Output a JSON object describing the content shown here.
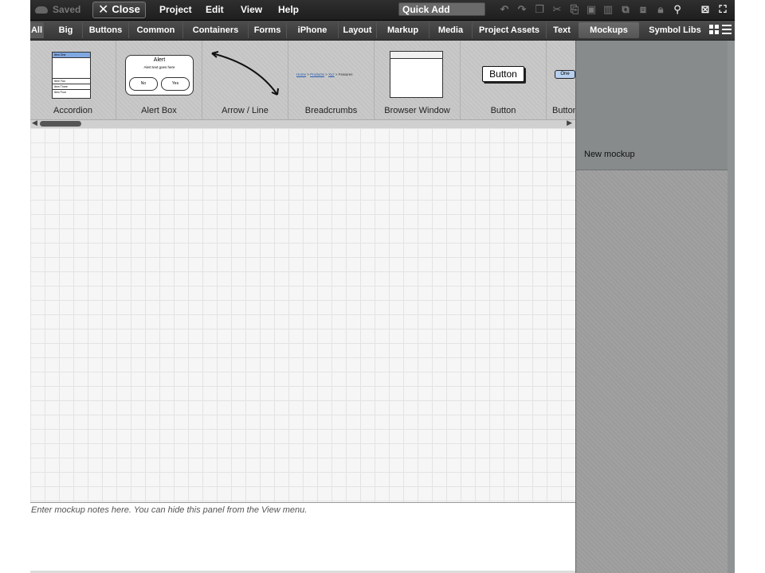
{
  "menubar": {
    "saved_label": "Saved",
    "close_label": "Close",
    "menus": [
      "Project",
      "Edit",
      "View",
      "Help"
    ],
    "quick_add": "Quick Add"
  },
  "categories": {
    "tabs": [
      "All",
      "Big",
      "Buttons",
      "Common",
      "Containers",
      "Forms",
      "iPhone",
      "Layout",
      "Markup",
      "Media",
      "Project Assets",
      "Text"
    ],
    "active": "All"
  },
  "right_tabs": {
    "mockups": "Mockups",
    "symbol_libs": "Symbol Libs"
  },
  "library": {
    "items": [
      "Accordion",
      "Alert Box",
      "Arrow / Line",
      "Breadcrumbs",
      "Browser Window",
      "Button",
      "Button Bar"
    ],
    "accordion_rows": [
      "Item One",
      "Item Two",
      "Item Three",
      "Item Four"
    ],
    "alert": {
      "title": "Alert",
      "text": "Alert text goes here",
      "no": "No",
      "yes": "Yes"
    },
    "breadcrumbs": {
      "home": "Home",
      "products": "Products",
      "xyz": "Xyz",
      "features": "Features"
    },
    "button_text": "Button",
    "buttonbar_text": "One"
  },
  "notes": {
    "placeholder": "Enter mockup notes here. You can hide this panel from the View menu."
  },
  "mockups_panel": {
    "items": [
      "New mockup"
    ]
  },
  "colors": {
    "accent_blue": "#7fa8e0",
    "menubar": "#1e1e1e",
    "panel_gray": "#878b8b"
  }
}
